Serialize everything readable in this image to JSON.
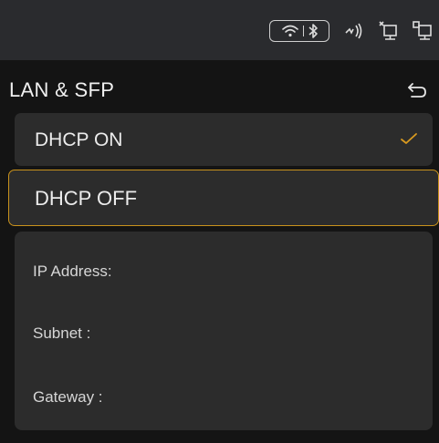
{
  "status_bar": {
    "icons": [
      "wifi-icon",
      "bluetooth-icon",
      "nfc-icon",
      "lan-disconnected-icon",
      "lan-connected-icon"
    ]
  },
  "header": {
    "title": "LAN & SFP",
    "back_icon": "back-arrow-icon"
  },
  "options": {
    "dhcp_on": {
      "label": "DHCP ON",
      "checked": true,
      "check_color": "#d99a1f"
    },
    "dhcp_off": {
      "label": "DHCP OFF",
      "highlight_color": "#c9921c"
    }
  },
  "fields": {
    "ip_address": "IP Address:",
    "subnet": "Subnet :",
    "gateway": "Gateway :"
  }
}
